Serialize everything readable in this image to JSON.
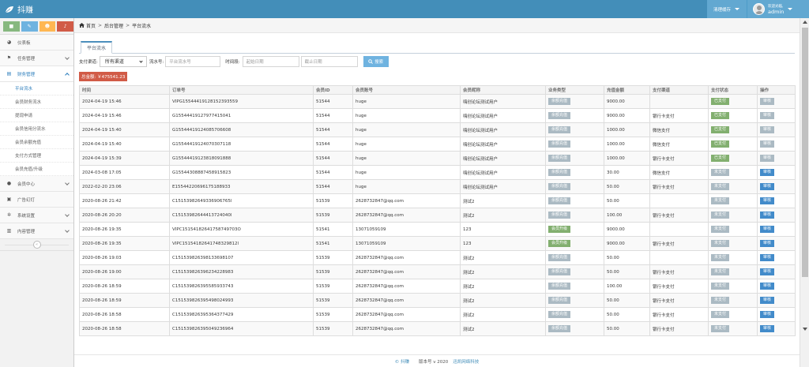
{
  "navbar": {
    "brand": "抖赚",
    "clear_cache": "清理缓存",
    "user_welcome": "欢迎光临,",
    "user_name": "admin"
  },
  "sidebar": {
    "items": [
      {
        "label": "仪表板",
        "icon": "dashboard-icon"
      },
      {
        "label": "任务管理",
        "icon": "flag-icon"
      },
      {
        "label": "财务管理",
        "icon": "print-icon"
      },
      {
        "label": "会员中心",
        "icon": "user-icon"
      },
      {
        "label": "广告幻灯",
        "icon": "picture-icon"
      },
      {
        "label": "系统设置",
        "icon": "gear-icon"
      },
      {
        "label": "内容管理",
        "icon": "book-icon"
      }
    ],
    "finance_sub": [
      "平台流水",
      "会员财务流水",
      "提现申请",
      "会员信用分流水",
      "会员余额充值",
      "支付方式管理",
      "会员充值/升级"
    ]
  },
  "breadcrumb": {
    "home": "首页",
    "level2": "后台管理",
    "level3": "平台流水"
  },
  "tab": "平台流水",
  "filter": {
    "channel_label": "支付渠道:",
    "channel_value": "所有渠道",
    "serial_label": "流水号:",
    "serial_placeholder": "平台流水号",
    "time_label": "时间段:",
    "start_placeholder": "起始日期",
    "end_placeholder": "截止日期",
    "search": "搜索"
  },
  "total": "总金额: ￥475541.23",
  "table": {
    "headers": [
      "时间",
      "订单号",
      "会员ID",
      "会员账号",
      "会员昵称",
      "业务类型",
      "充值金额",
      "支付渠道",
      "支付状态",
      "操作"
    ],
    "rows": [
      [
        "2024-04-19 15:46",
        "VIPG15544419128152393559",
        "51544",
        "huge",
        "嗨创论坛测试用户",
        "余额充值",
        "9000.00",
        "",
        "已支付",
        "审核"
      ],
      [
        "2024-04-19 15:46",
        "G15544419127977415041",
        "51544",
        "huge",
        "嗨创论坛测试用户",
        "余额充值",
        "9000.00",
        "银行卡支付",
        "已支付",
        "审核"
      ],
      [
        "2024-04-19 15:40",
        "G15544419124085706608",
        "51544",
        "huge",
        "嗨创论坛测试用户",
        "余额充值",
        "1000.00",
        "微信支付",
        "已支付",
        "审核"
      ],
      [
        "2024-04-19 15:40",
        "G15544419124070307118",
        "51544",
        "huge",
        "嗨创论坛测试用户",
        "余额充值",
        "1000.00",
        "微信支付",
        "已支付",
        "审核"
      ],
      [
        "2024-04-19 15:39",
        "G15544419123818091888",
        "51544",
        "huge",
        "嗨创论坛测试用户",
        "余额充值",
        "1000.00",
        "银行卡支付",
        "已支付",
        "审核"
      ],
      [
        "2024-03-08 17:05",
        "G15544308887458915823",
        "51544",
        "huge",
        "嗨创论坛测试用户",
        "余额充值",
        "30.00",
        "微信支付",
        "未支付",
        "审核"
      ],
      [
        "2022-02-20 23:06",
        "E15544220696175188933",
        "51544",
        "huge",
        "嗨创论坛测试用户",
        "余额充值",
        "50.00",
        "银行卡支付",
        "未支付",
        "审核"
      ],
      [
        "2020-08-26 21:42",
        "C15153982649336906765l",
        "51539",
        "2628732847@qq.com",
        "测试2",
        "余额充值",
        "50.00",
        "",
        "未支付",
        "审核"
      ],
      [
        "2020-08-26 20:20",
        "C15153982644413724040l",
        "51539",
        "2628732847@qq.com",
        "测试2",
        "余额充值",
        "100.00",
        "银行卡支付",
        "未支付",
        "审核"
      ],
      [
        "2020-08-26 19:35",
        "VIPC15154182641758749703O",
        "51541",
        "13071059109",
        "123",
        "会员升级",
        "9000.00",
        "",
        "未支付",
        "审核"
      ],
      [
        "2020-08-26 19:35",
        "VIPC15154182641748329812l",
        "51541",
        "13071059109",
        "123",
        "会员升级",
        "9000.00",
        "银行卡支付",
        "未支付",
        "审核"
      ],
      [
        "2020-08-26 19:03",
        "C15153982639813369810​7",
        "51539",
        "2628732847@qq.com",
        "测试2",
        "余额充值",
        "50.00",
        "",
        "未支付",
        "审核"
      ],
      [
        "2020-08-26 19:00",
        "C15153982639623422898​3",
        "51539",
        "2628732847@qq.com",
        "测试2",
        "余额充值",
        "50.00",
        "银行卡支付",
        "未支付",
        "审核"
      ],
      [
        "2020-08-26 18:59",
        "C15153982639558593374​3",
        "51539",
        "2628732847@qq.com",
        "测试2",
        "余额充值",
        "100.00",
        "银行卡支付",
        "未支付",
        "审核"
      ],
      [
        "2020-08-26 18:59",
        "C15153982639549802499​3",
        "51539",
        "2628732847@qq.com",
        "测试2",
        "余额充值",
        "50.00",
        "银行卡支付",
        "未支付",
        "审核"
      ],
      [
        "2020-08-26 18:58",
        "C15153982639536437742​9",
        "51539",
        "2628732847@qq.com",
        "测试2",
        "余额充值",
        "50.00",
        "银行卡支付",
        "未支付",
        "审核"
      ],
      [
        "2020-08-26 18:58",
        "C15153982639504923696​4",
        "51539",
        "2628732847@qq.com",
        "测试2",
        "余额充值",
        "50.00",
        "银行卡支付",
        "未支付",
        "审核"
      ]
    ]
  },
  "footer": {
    "brand": "© 抖赚",
    "version": "版本号 v 2020",
    "company": "迅凯网络科技"
  },
  "colors": {
    "navbar": "#438eb9",
    "paid": "#82af6f",
    "unpaid": "#abbac3",
    "audit": "#428bca",
    "total": "#d15b47"
  }
}
